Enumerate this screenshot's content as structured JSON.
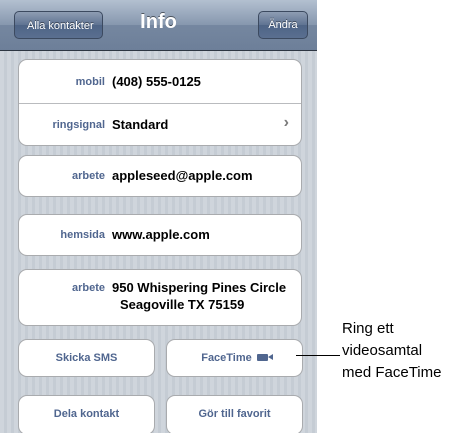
{
  "navbar": {
    "back_label": "Alla kontakter",
    "title": "Info",
    "edit_label": "Ändra"
  },
  "phone_group": {
    "mobile_label": "mobil",
    "mobile_value": "(408) 555-0125",
    "ringtone_label": "ringsignal",
    "ringtone_value": "Standard"
  },
  "email": {
    "label": "arbete",
    "value": "appleseed@apple.com"
  },
  "homepage": {
    "label": "hemsida",
    "value": "www.apple.com"
  },
  "address": {
    "label": "arbete",
    "line1": "950 Whispering Pines Circle",
    "line2": "Seagoville TX 75159"
  },
  "buttons": {
    "sms": "Skicka SMS",
    "facetime": "FaceTime",
    "share": "Dela kontakt",
    "favorite": "Gör till favorit"
  },
  "callout": {
    "line1": "Ring ett",
    "line2": "videosamtal",
    "line3": "med FaceTime"
  },
  "colors": {
    "label": "#50668f",
    "navbar": "#7587a0",
    "background": "#c5ccd4"
  }
}
